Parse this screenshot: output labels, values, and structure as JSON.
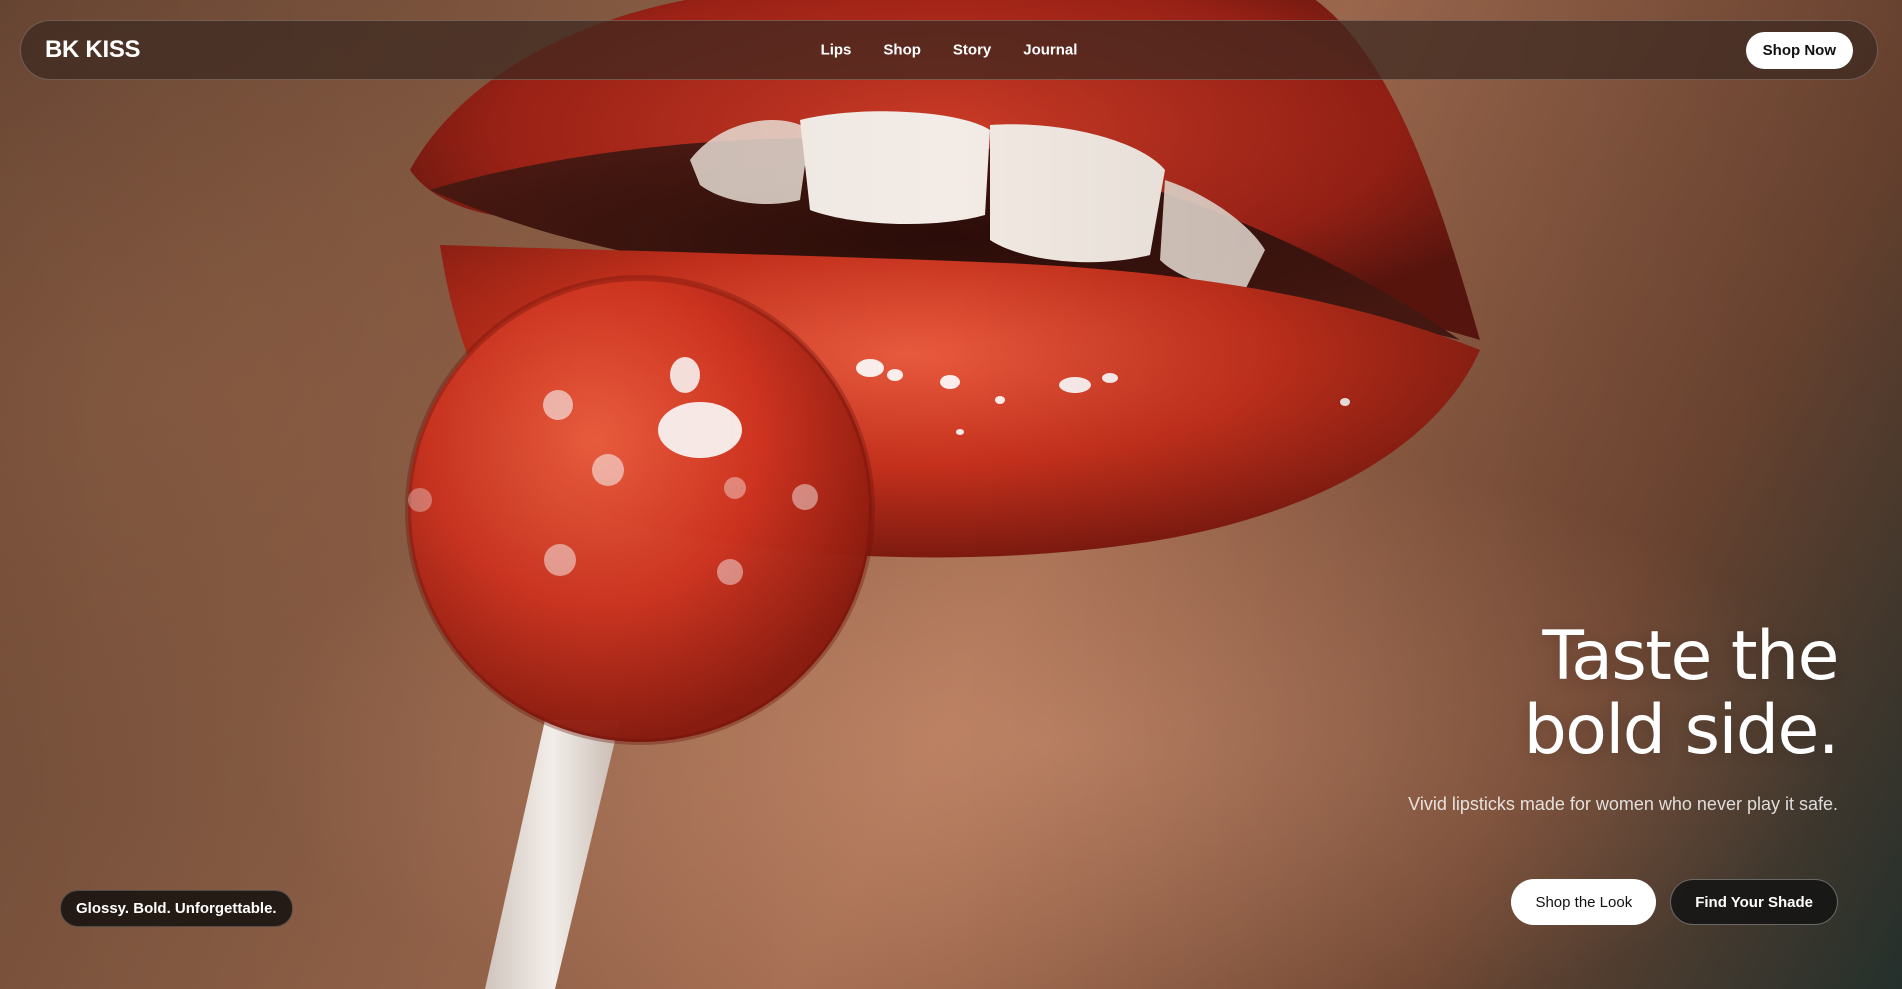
{
  "nav": {
    "brand": "BK KISS",
    "links": [
      {
        "label": "Lips"
      },
      {
        "label": "Shop"
      },
      {
        "label": "Story"
      },
      {
        "label": "Journal"
      }
    ],
    "cta_label": "Shop Now"
  },
  "hero": {
    "title_line_1": "Taste the",
    "title_line_2": "bold side.",
    "subtitle": "Vivid lipsticks made for women who never play it safe.",
    "primary_cta": "Shop the Look",
    "secondary_cta": "Find Your Shade",
    "tagline": "Glossy. Bold. Unforgettable."
  },
  "colors": {
    "lip_red": "#c8321e",
    "candy_red": "#d63a22",
    "skin_tone": "#a66e52",
    "overlay_dark": "#3c2820"
  }
}
